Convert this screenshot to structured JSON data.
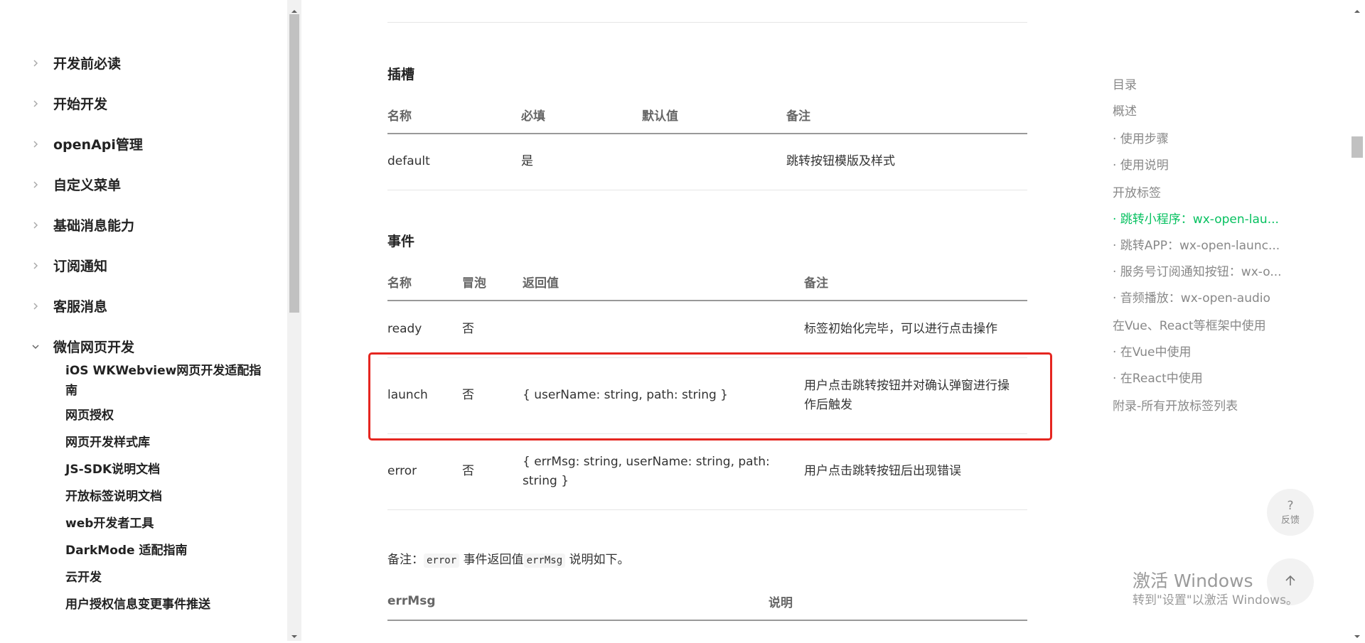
{
  "sidebar": {
    "sections": [
      {
        "label": "开发前必读",
        "expanded": false
      },
      {
        "label": "开始开发",
        "expanded": false
      },
      {
        "label": "openApi管理",
        "expanded": false
      },
      {
        "label": "自定义菜单",
        "expanded": false
      },
      {
        "label": "基础消息能力",
        "expanded": false
      },
      {
        "label": "订阅通知",
        "expanded": false
      },
      {
        "label": "客服消息",
        "expanded": false
      },
      {
        "label": "微信网页开发",
        "expanded": true
      }
    ],
    "sub_items": [
      "iOS WKWebview网页开发适配指南",
      "网页授权",
      "网页开发样式库",
      "JS-SDK说明文档",
      "开放标签说明文档",
      "web开发者工具",
      "DarkMode 适配指南",
      "云开发",
      "用户授权信息变更事件推送"
    ]
  },
  "main": {
    "slots": {
      "title": "插槽",
      "headers": [
        "名称",
        "必填",
        "默认值",
        "备注"
      ],
      "rows": [
        [
          "default",
          "是",
          "",
          "跳转按钮模版及样式"
        ]
      ]
    },
    "events": {
      "title": "事件",
      "headers": [
        "名称",
        "冒泡",
        "返回值",
        "备注"
      ],
      "rows": [
        [
          "ready",
          "否",
          "",
          "标签初始化完毕，可以进行点击操作"
        ],
        [
          "launch",
          "否",
          "{ userName: string, path: string }",
          "用户点击跳转按钮并对确认弹窗进行操作后触发"
        ],
        [
          "error",
          "否",
          "{ errMsg: string, userName: string, path: string }",
          "用户点击跳转按钮后出现错误"
        ]
      ]
    },
    "note": {
      "prefix": "备注：",
      "code1": "error",
      "mid": "事件返回值",
      "code2": "errMsg",
      "suffix": "说明如下。"
    },
    "errmsg_table": {
      "headers": [
        "errMsg",
        "说明"
      ]
    }
  },
  "toc": {
    "items": [
      {
        "label": "目录",
        "level": 1,
        "active": false
      },
      {
        "label": "概述",
        "level": 1,
        "active": false
      },
      {
        "label": "· 使用步骤",
        "level": 2,
        "active": false
      },
      {
        "label": "· 使用说明",
        "level": 2,
        "active": false
      },
      {
        "label": "开放标签",
        "level": 1,
        "active": false
      },
      {
        "label": "· 跳转小程序：wx-open-lau...",
        "level": 2,
        "active": true
      },
      {
        "label": "· 跳转APP：wx-open-launc...",
        "level": 2,
        "active": false
      },
      {
        "label": "· 服务号订阅通知按钮：wx-o...",
        "level": 2,
        "active": false
      },
      {
        "label": "· 音频播放：wx-open-audio",
        "level": 2,
        "active": false
      },
      {
        "label": "在Vue、React等框架中使用",
        "level": 1,
        "active": false
      },
      {
        "label": "· 在Vue中使用",
        "level": 2,
        "active": false
      },
      {
        "label": "· 在React中使用",
        "level": 2,
        "active": false
      },
      {
        "label": "附录-所有开放标签列表",
        "level": 1,
        "active": false
      }
    ]
  },
  "floating": {
    "feedback_icon": "?",
    "feedback_label": "反馈",
    "top_icon": "arrow-up-icon"
  },
  "watermark": {
    "line1": "激活 Windows",
    "line2": "转到\"设置\"以激活 Windows。"
  },
  "colors": {
    "accent": "#07c160",
    "highlight_box": "#e52620"
  }
}
